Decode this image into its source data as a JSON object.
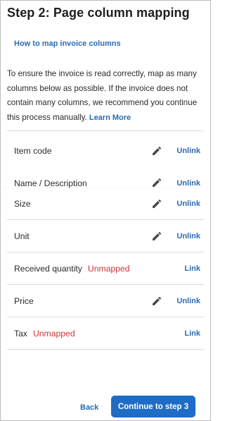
{
  "header": {
    "title": "Step 2: Page column mapping"
  },
  "help": {
    "link_label": "How to map invoice columns"
  },
  "intro": {
    "text": "To ensure the invoice is read correctly, map as many columns below as possible. If the invoice does not contain many columns, we recommend you continue this process manually.",
    "learn_more": "Learn More"
  },
  "rows": [
    {
      "label": "Item code",
      "status": "",
      "action": "Unlink",
      "editable": true
    },
    {
      "label": "Name / Description",
      "status": "",
      "action": "Unlink",
      "editable": true
    },
    {
      "label": "Size",
      "status": "",
      "action": "Unlink",
      "editable": true
    },
    {
      "label": "Unit",
      "status": "",
      "action": "Unlink",
      "editable": true
    },
    {
      "label": "Received quantity",
      "status": "Unmapped",
      "action": "Link",
      "editable": false
    },
    {
      "label": "Price",
      "status": "",
      "action": "Unlink",
      "editable": true
    },
    {
      "label": "Tax",
      "status": "Unmapped",
      "action": "Link",
      "editable": false
    }
  ],
  "footer": {
    "back_label": "Back",
    "continue_label": "Continue to step 3"
  },
  "colors": {
    "accent": "#1e6cc5",
    "link": "#2b6cb0",
    "unmapped": "#d13438",
    "divider": "#dcdcdc"
  }
}
